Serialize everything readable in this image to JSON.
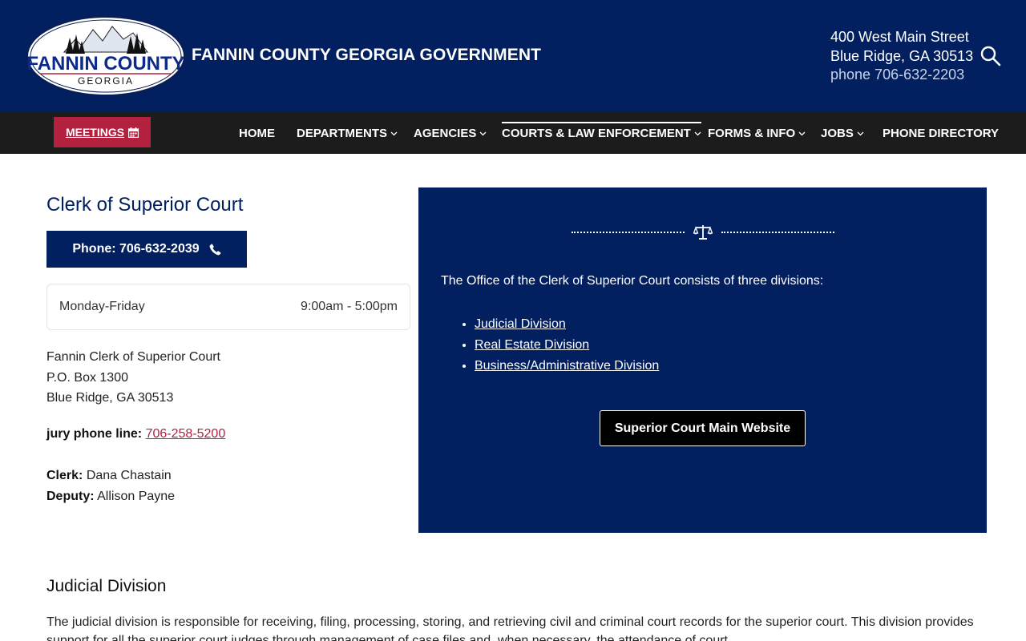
{
  "header": {
    "logo_text": "FANNIN COUNTY",
    "logo_subtext": "GEORGIA",
    "site_title": "FANNIN COUNTY GEORGIA GOVERNMENT",
    "address_line1": "400 West Main Street",
    "address_line2": "Blue Ridge, GA 30513",
    "phone": "phone 706-632-2203"
  },
  "nav": {
    "meetings_label": "MEETINGS",
    "items": [
      {
        "label": "HOME"
      },
      {
        "label": "DEPARTMENTS"
      },
      {
        "label": "AGENCIES"
      },
      {
        "label": "COURTS & LAW ENFORCEMENT"
      },
      {
        "label": "FORMS & INFO"
      },
      {
        "label": "JOBS"
      },
      {
        "label": "PHONE DIRECTORY"
      }
    ]
  },
  "page": {
    "title": "Clerk of Superior Court",
    "phone_button": "Phone: 706-632-2039",
    "hours_days": "Monday-Friday",
    "hours_time": "9:00am - 5:00pm",
    "office_name": "Fannin Clerk of Superior Court",
    "office_box": "P.O. Box 1300",
    "office_city": "Blue Ridge, GA 30513",
    "jury_label": "jury phone line:",
    "jury_phone": "706-258-5200",
    "clerk_label": "Clerk:",
    "clerk_name": "Dana Chastain",
    "deputy_label": "Deputy:",
    "deputy_name": "Allison Payne"
  },
  "panel": {
    "intro": "The Office of the Clerk of Superior Court consists of three divisions:",
    "divisions": [
      "Judicial Division",
      "Real Estate Division",
      "Business/Administrative Division"
    ],
    "button_label": "Superior Court Main Website"
  },
  "section": {
    "title": "Judicial Division",
    "body": "The judicial division is responsible for receiving, filing, processing, storing, and retrieving civil and criminal court records for the superior court. This division provides support for all the superior court judges through management of case files and, when necessary, the attendance of court."
  }
}
